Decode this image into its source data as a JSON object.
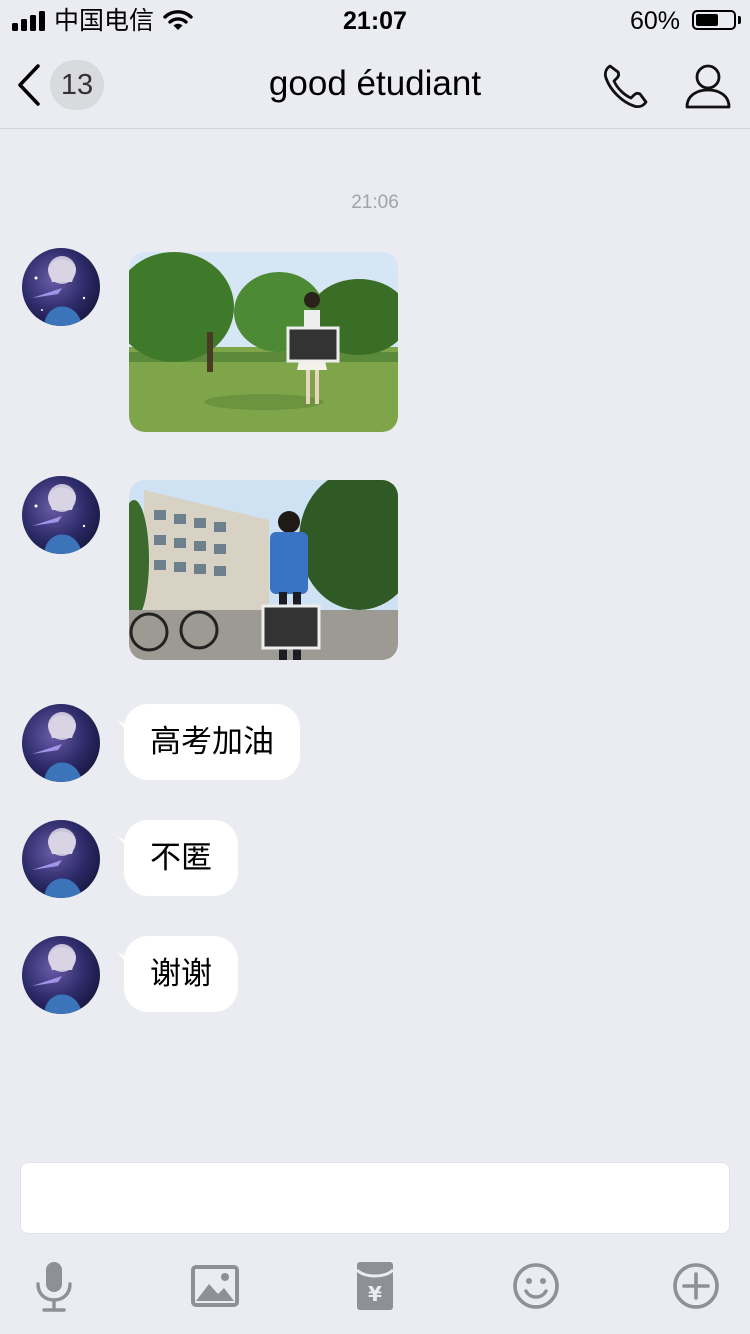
{
  "status_bar": {
    "carrier": "中国电信",
    "time": "21:07",
    "battery_percent": "60%",
    "battery_level": 0.6,
    "icons": [
      "signal-icon",
      "wifi-icon",
      "battery-icon"
    ]
  },
  "nav": {
    "back_icon": "chevron-left-icon",
    "unread_count": "13",
    "title": "good étudiant",
    "call_icon": "phone-icon",
    "profile_icon": "person-icon"
  },
  "chat": {
    "timestamp": "21:06",
    "messages": [
      {
        "type": "image",
        "description_icon": "photo-girl-holding-chalkboard"
      },
      {
        "type": "image",
        "description_icon": "photo-boy-holding-chalkboard"
      },
      {
        "type": "text",
        "text": "高考加油"
      },
      {
        "type": "text",
        "text": "不匿"
      },
      {
        "type": "text",
        "text": "谢谢"
      }
    ]
  },
  "input": {
    "value": "",
    "placeholder": ""
  },
  "toolbar": {
    "icons": [
      "microphone-icon",
      "image-icon",
      "red-packet-icon",
      "emoji-icon",
      "plus-circle-icon"
    ]
  },
  "colors": {
    "background": "#ebecf1",
    "bubble": "#ffffff",
    "icon_gray": "#8e9097",
    "badge": "#d9dade"
  }
}
